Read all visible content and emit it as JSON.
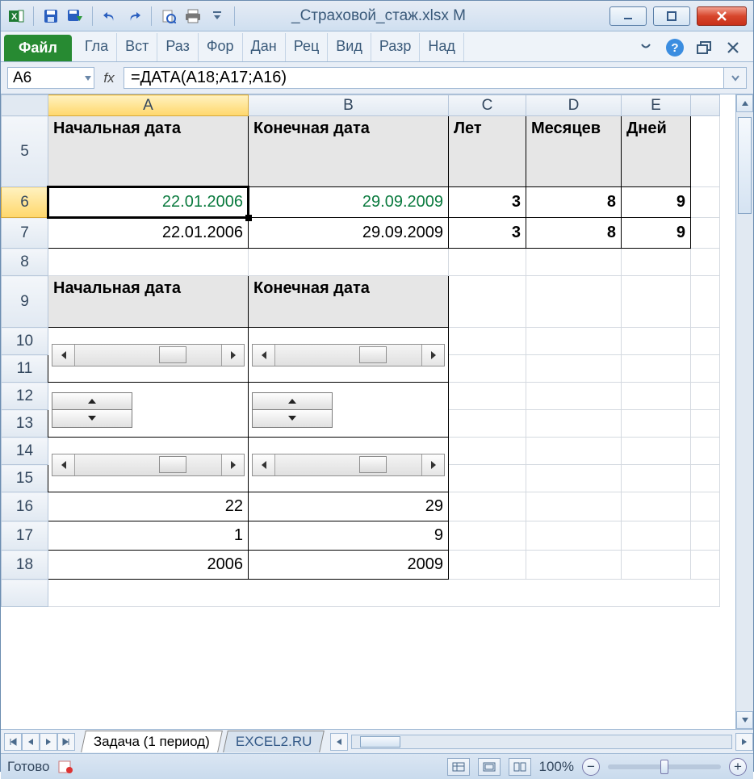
{
  "window": {
    "filename": "_Страховой_стаж.xlsx M"
  },
  "ribbon": {
    "file": "Файл",
    "tabs": [
      "Гла",
      "Вст",
      "Раз",
      "Фор",
      "Дан",
      "Рец",
      "Вид",
      "Разр",
      "Над"
    ]
  },
  "formula_bar": {
    "name_box": "A6",
    "fx_label": "fx",
    "formula": "=ДАТА(A18;A17;A16)"
  },
  "columns": [
    "A",
    "B",
    "C",
    "D",
    "E"
  ],
  "rows": [
    "5",
    "6",
    "7",
    "8",
    "9",
    "10",
    "11",
    "12",
    "13",
    "14",
    "15",
    "16",
    "17",
    "18"
  ],
  "selected_column": "A",
  "selected_row": "6",
  "cells": {
    "hdr1_a": "Начальная дата",
    "hdr1_b": "Конечная дата",
    "hdr1_c": "Лет",
    "hdr1_d": "Месяцев",
    "hdr1_e": "Дней",
    "r6_a": "22.01.2006",
    "r6_b": "29.09.2009",
    "r6_c": "3",
    "r6_d": "8",
    "r6_e": "9",
    "r7_a": "22.01.2006",
    "r7_b": "29.09.2009",
    "r7_c": "3",
    "r7_d": "8",
    "r7_e": "9",
    "hdr2_a": "Начальная дата",
    "hdr2_b": "Конечная дата",
    "r16_a": "22",
    "r16_b": "29",
    "r17_a": "1",
    "r17_b": "9",
    "r18_a": "2006",
    "r18_b": "2009"
  },
  "sheet_tabs": {
    "active": "Задача (1 период)",
    "inactive": "EXCEL2.RU"
  },
  "status": {
    "ready": "Готово",
    "zoom": "100%"
  },
  "icons": {
    "minus": "−",
    "plus": "+"
  }
}
